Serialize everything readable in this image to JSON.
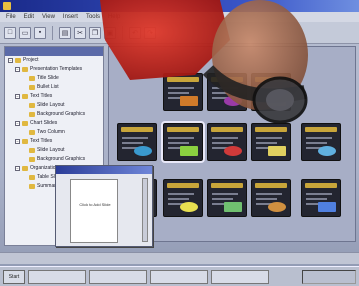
{
  "window": {
    "title": "",
    "menu": [
      "File",
      "Edit",
      "View",
      "Insert",
      "Tools",
      "Help"
    ]
  },
  "toolbar": {
    "buttons": [
      "new-icon",
      "open-icon",
      "save-icon",
      "print-icon",
      "cut-icon",
      "copy-icon",
      "paste-icon",
      "undo-icon",
      "redo-icon"
    ]
  },
  "tree": {
    "items": [
      {
        "label": "Project",
        "level": 0
      },
      {
        "label": "Presentation Templates",
        "level": 1
      },
      {
        "label": "Title Slide",
        "level": 2
      },
      {
        "label": "Bullet List",
        "level": 2
      },
      {
        "label": "Text Titles",
        "level": 1
      },
      {
        "label": "Slide Layout",
        "level": 2
      },
      {
        "label": "Background Graphics",
        "level": 2
      },
      {
        "label": "Chart Slides",
        "level": 1
      },
      {
        "label": "Two Column",
        "level": 2
      },
      {
        "label": "Text Titles",
        "level": 1
      },
      {
        "label": "Slide Layout",
        "level": 2
      },
      {
        "label": "Background Graphics",
        "level": 2
      },
      {
        "label": "Organization Chart",
        "level": 1
      },
      {
        "label": "Table Slide",
        "level": 2
      },
      {
        "label": "Summary",
        "level": 2
      }
    ]
  },
  "dialog": {
    "title": "",
    "text": "Click to Add Slide"
  },
  "statusbar": {
    "text": ""
  },
  "taskbar": {
    "start_label": "Start",
    "tasks": [
      "",
      "",
      "",
      ""
    ],
    "clock": ""
  },
  "colors": {
    "accent": "#3a56c8",
    "thumb_bg": "#232530",
    "thumb_title": "#c8a53a",
    "person_red": "#c8201c"
  }
}
